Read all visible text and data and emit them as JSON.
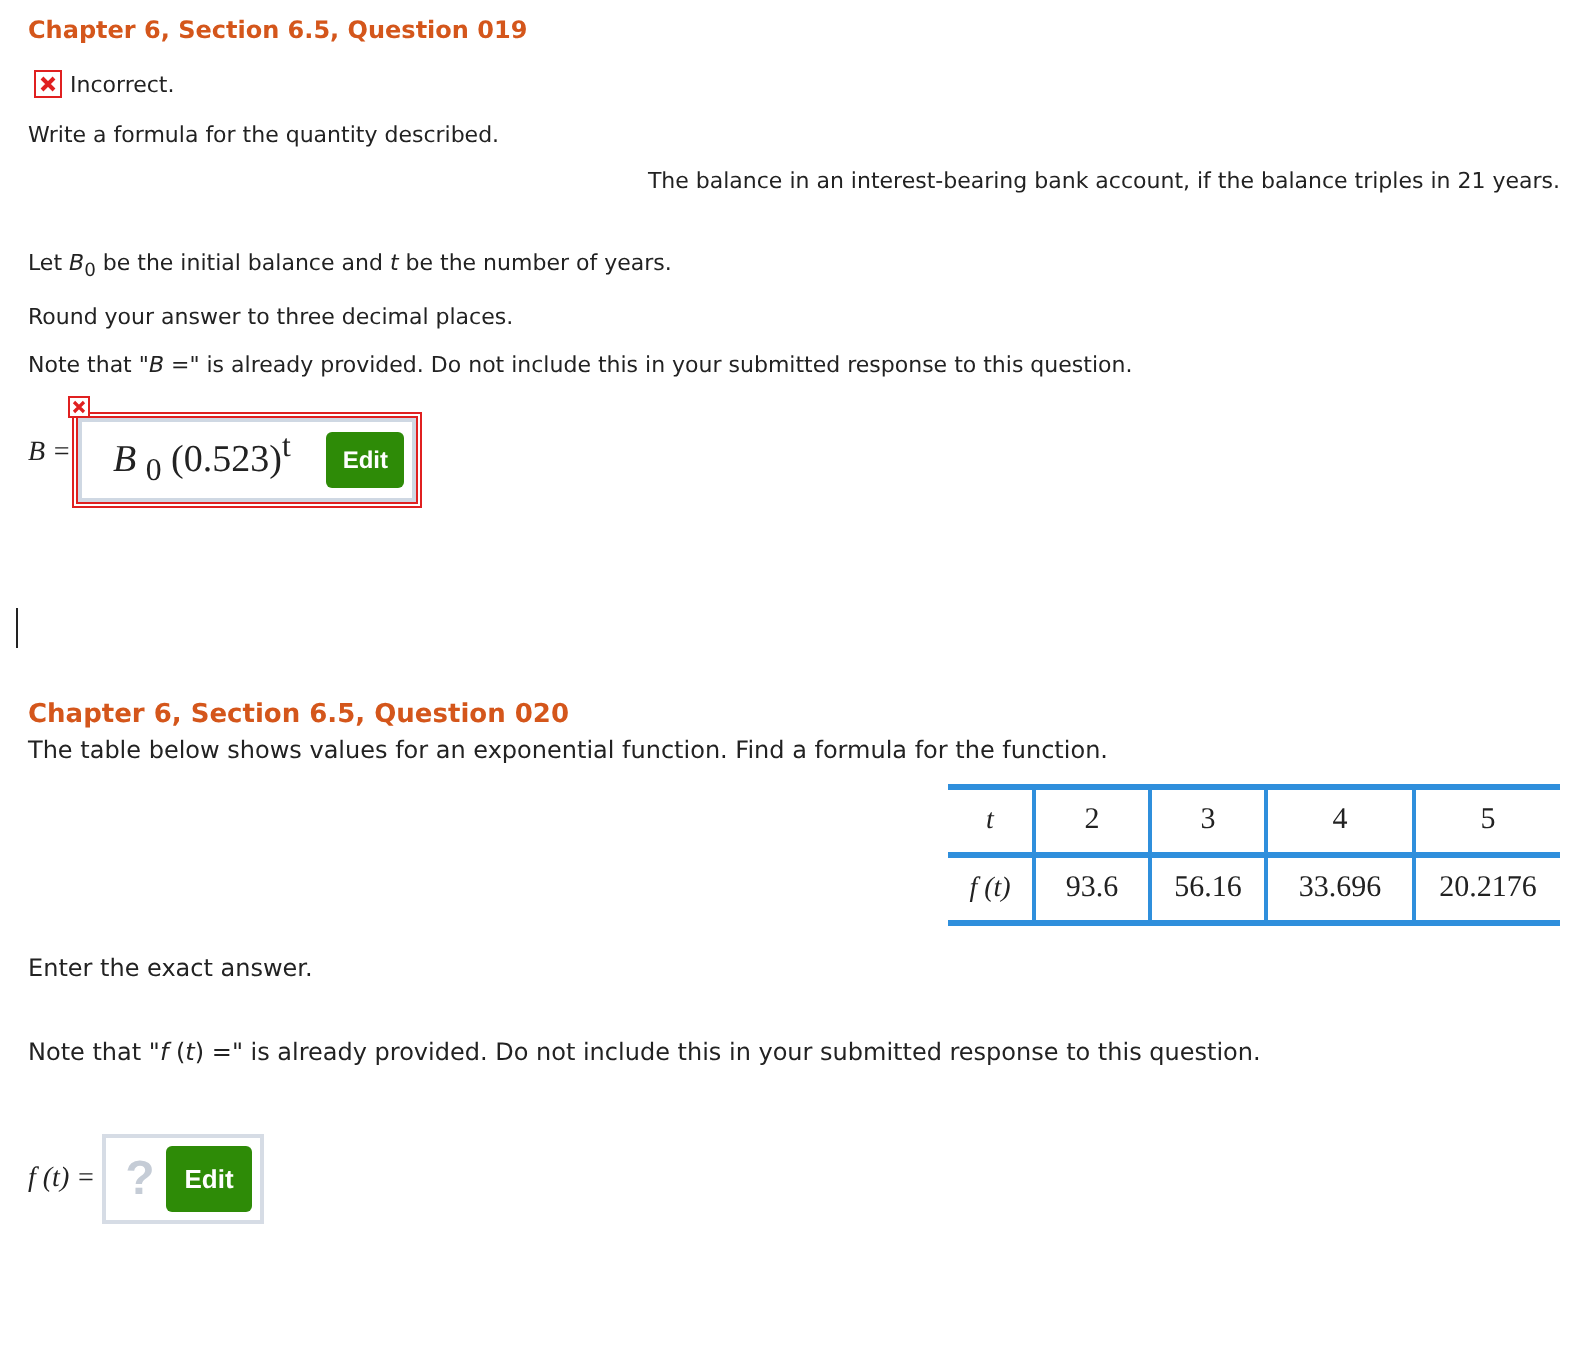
{
  "question_019": {
    "title": "Chapter 6, Section 6.5, Question 019",
    "result": {
      "correct": false,
      "label": "Incorrect."
    },
    "instruction": "Write a formula for the quantity described.",
    "description": "The balance in an interest-bearing bank account, if the balance triples in 21 years.",
    "notes": [
      "Let *B*$_{0}$ be the initial balance and *t* be the number of years.",
      "Round your answer to three decimal places.",
      "Note that \"*B* =\" is already provided. Do not include this in your submitted response to this question."
    ],
    "answer": {
      "prefix": "B =",
      "value": "*B* $_{0}$ (0.523)$^{t}$",
      "correct": false,
      "button": "Edit"
    }
  },
  "question_020": {
    "title": "Chapter 6, Section 6.5, Question 020",
    "instruction": "The table below shows values for an exponential function. Find a formula for the function.",
    "table": {
      "rows": [
        {
          "header": "t",
          "cells": [
            "2",
            "3",
            "4",
            "5"
          ]
        },
        {
          "header": "f (t)",
          "cells": [
            "93.6",
            "56.16",
            "33.696",
            "20.2176"
          ]
        }
      ]
    },
    "notes": [
      "Enter the exact answer.",
      "Note that \"*f* (*t*) =\" is already provided. Do not include this in your submitted response to this question."
    ],
    "answer": {
      "prefix": "f (t) =",
      "placeholder": "?",
      "button": "Edit"
    }
  }
}
